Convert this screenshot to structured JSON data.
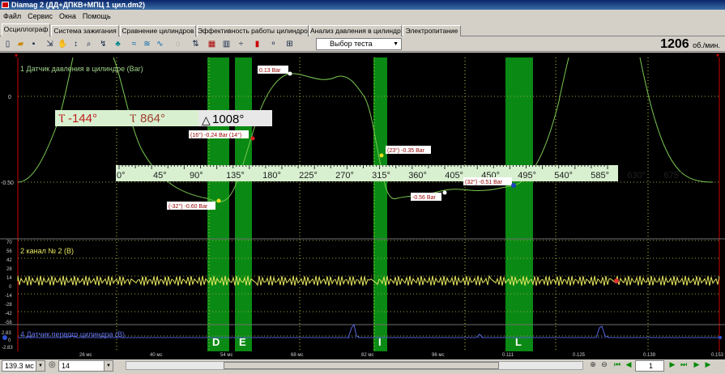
{
  "window": {
    "title": "Diamag 2 (ДД+ДПКВ+МПЦ 1 цил.dm2)"
  },
  "menu": [
    "Файл",
    "Сервис",
    "Окна",
    "Помощь"
  ],
  "tabs": [
    {
      "label": "Осциллограф",
      "active": true
    },
    {
      "label": "Система зажигания"
    },
    {
      "label": "Сравнение цилиндров"
    },
    {
      "label": "Эффективность работы цилиндров"
    },
    {
      "label": "Анализ давления в цилиндре"
    },
    {
      "label": "Электропитание"
    }
  ],
  "toolbar": {
    "icons": [
      "new-icon",
      "open-icon",
      "save-icon",
      "cursor-icon",
      "hand-icon",
      "marker-icon",
      "zoom-icon",
      "filter-icon",
      "wave-icon",
      "wave2-icon",
      "wave3-icon",
      "probe-icon",
      "grid-icon",
      "table-icon",
      "split-icon",
      "bars-icon",
      "gauge-icon"
    ],
    "test_select": "Выбор теста",
    "rpm_value": "1206",
    "rpm_unit": "об./мин."
  },
  "cursors": {
    "start": "-144°",
    "end": "864°",
    "delta": "1008°"
  },
  "angle_scale": [
    "0°",
    "45°",
    "90°",
    "135°",
    "180°",
    "225°",
    "270°",
    "315°",
    "360°",
    "405°",
    "450°",
    "495°",
    "540°",
    "585°",
    "630°",
    "675°"
  ],
  "channels": [
    {
      "label": "1 Датчик давления в цилиндре (Bar)",
      "color": "#9fd08a",
      "ticks": [
        "0",
        "-0.50"
      ]
    },
    {
      "label": "2 канал № 2 (В)",
      "color": "#e8e860",
      "ticks": [
        "70",
        "56",
        "42",
        "28",
        "14",
        "0",
        "-14",
        "-28",
        "-42",
        "-56"
      ]
    },
    {
      "label": "4 Датчик первого цилиндра (В)",
      "color": "#6070e8",
      "ticks": [
        "2.83",
        "0",
        "-2.83"
      ]
    }
  ],
  "annotations": [
    {
      "text": "0.13 Bar"
    },
    {
      "text": "(16°) -0.24 Bar (14°)"
    },
    {
      "text": "(23°) -0.35 Bar"
    },
    {
      "text": "-0.56 Bar"
    },
    {
      "text": "(32°) -0.51 Bar"
    },
    {
      "text": "(-32°) -0.60 Bar"
    }
  ],
  "zones": [
    "D",
    "E",
    "I",
    "L"
  ],
  "time_axis": [
    "26 мс",
    "40 мс",
    "54 мс",
    "68 мс",
    "82 мс",
    "96 мс",
    "0.111",
    "0.125",
    "0.139",
    "0.153"
  ],
  "bottom": {
    "time_value": "139.3 мс",
    "channel_value": "14",
    "page_value": "1"
  }
}
